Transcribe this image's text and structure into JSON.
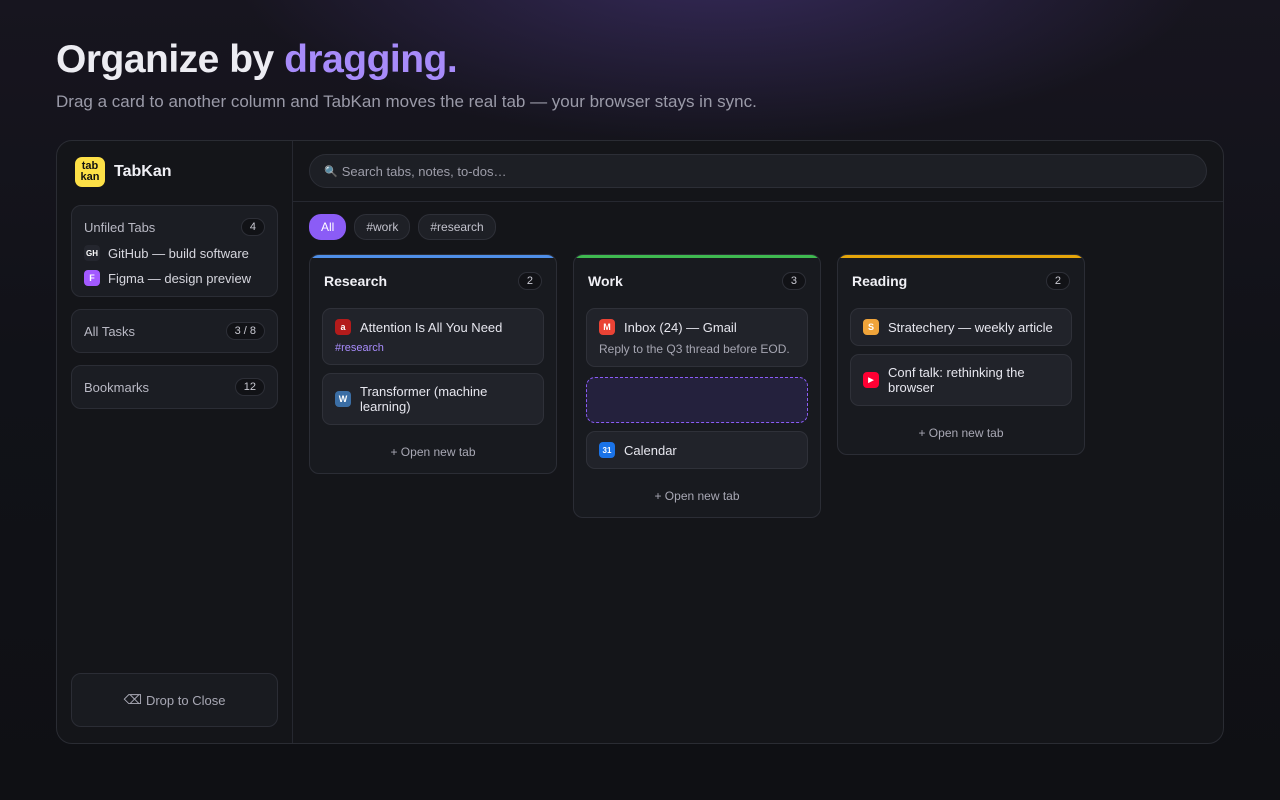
{
  "hero": {
    "title_prefix": "Organize by ",
    "title_accent": "dragging.",
    "subtitle": "Drag a card to another column and TabKan moves the real tab — your browser stays in sync."
  },
  "app": {
    "name": "TabKan",
    "logo_line1": "tab",
    "logo_line2": "kan"
  },
  "sidebar": {
    "unfiled": {
      "title": "Unfiled Tabs",
      "count": "4",
      "tabs": [
        {
          "icon": "github-icon",
          "favicon": "GH",
          "label": "GitHub — build software"
        },
        {
          "icon": "figma-icon",
          "favicon": "F",
          "label": "Figma — design preview"
        }
      ]
    },
    "all_tasks": {
      "title": "All Tasks",
      "count": "3 / 8"
    },
    "bookmarks": {
      "title": "Bookmarks",
      "count": "12"
    },
    "drop_close": {
      "icon": "⌫",
      "label": "Drop to Close"
    }
  },
  "search": {
    "icon": "🔍",
    "placeholder": "Search tabs, notes, to-dos…"
  },
  "filters": [
    "All",
    "#work",
    "#research"
  ],
  "columns": [
    {
      "title": "Research",
      "count": "2",
      "color": "#4f8fe8",
      "cards": [
        {
          "favicon": "a",
          "label": "Attention Is All You Need",
          "tag": "#research"
        },
        {
          "favicon": "W",
          "label": "Transformer (machine learning)"
        }
      ],
      "open_new": "+ Open new tab"
    },
    {
      "title": "Work",
      "count": "3",
      "color": "#3fb950",
      "cards": [
        {
          "favicon": "M",
          "label": "Inbox (24) — Gmail",
          "note": "Reply to the Q3 thread before EOD."
        },
        {
          "favicon": "31",
          "label": "Calendar"
        }
      ],
      "open_new": "+ Open new tab"
    },
    {
      "title": "Reading",
      "count": "2",
      "color": "#e5a50a",
      "cards": [
        {
          "favicon": "S",
          "label": "Stratechery — weekly article"
        },
        {
          "favicon": "▶",
          "label": "Conf talk: rethinking the browser"
        }
      ],
      "open_new": "+ Open new tab"
    }
  ]
}
